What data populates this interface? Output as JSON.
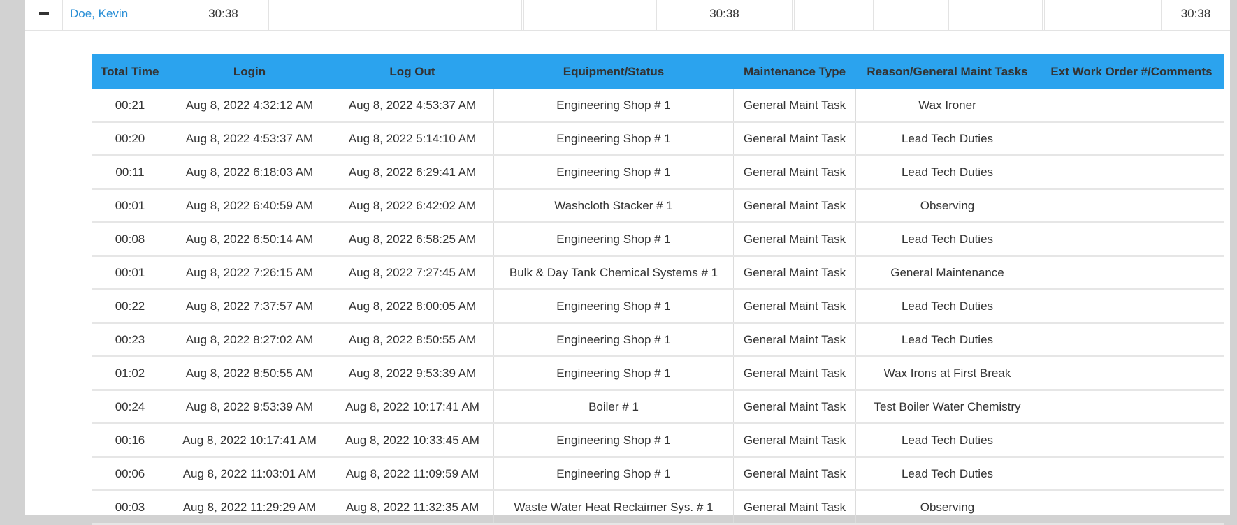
{
  "summary": {
    "employee": "Doe, Kevin",
    "total": "30:38",
    "col7": "30:38",
    "col13": "30:38"
  },
  "detail": {
    "headers": {
      "total_time": "Total Time",
      "login": "Login",
      "logout": "Log Out",
      "equipment": "Equipment/Status",
      "maint_type": "Maintenance Type",
      "reason": "Reason/General Maint Tasks",
      "comments": "Ext Work Order #/Comments"
    },
    "rows": [
      {
        "total": "00:21",
        "login": "Aug 8, 2022 4:32:12 AM",
        "logout": "Aug 8, 2022 4:53:37 AM",
        "equipment": "Engineering Shop # 1",
        "type": "General Maint Task",
        "reason": "Wax Ironer",
        "comment": ""
      },
      {
        "total": "00:20",
        "login": "Aug 8, 2022 4:53:37 AM",
        "logout": "Aug 8, 2022 5:14:10 AM",
        "equipment": "Engineering Shop # 1",
        "type": "General Maint Task",
        "reason": "Lead Tech Duties",
        "comment": ""
      },
      {
        "total": "00:11",
        "login": "Aug 8, 2022 6:18:03 AM",
        "logout": "Aug 8, 2022 6:29:41 AM",
        "equipment": "Engineering Shop # 1",
        "type": "General Maint Task",
        "reason": "Lead Tech Duties",
        "comment": ""
      },
      {
        "total": "00:01",
        "login": "Aug 8, 2022 6:40:59 AM",
        "logout": "Aug 8, 2022 6:42:02 AM",
        "equipment": "Washcloth Stacker # 1",
        "type": "General Maint Task",
        "reason": "Observing",
        "comment": ""
      },
      {
        "total": "00:08",
        "login": "Aug 8, 2022 6:50:14 AM",
        "logout": "Aug 8, 2022 6:58:25 AM",
        "equipment": "Engineering Shop # 1",
        "type": "General Maint Task",
        "reason": "Lead Tech Duties",
        "comment": ""
      },
      {
        "total": "00:01",
        "login": "Aug 8, 2022 7:26:15 AM",
        "logout": "Aug 8, 2022 7:27:45 AM",
        "equipment": "Bulk & Day Tank Chemical Systems # 1",
        "type": "General Maint Task",
        "reason": "General Maintenance",
        "comment": ""
      },
      {
        "total": "00:22",
        "login": "Aug 8, 2022 7:37:57 AM",
        "logout": "Aug 8, 2022 8:00:05 AM",
        "equipment": "Engineering Shop # 1",
        "type": "General Maint Task",
        "reason": "Lead Tech Duties",
        "comment": ""
      },
      {
        "total": "00:23",
        "login": "Aug 8, 2022 8:27:02 AM",
        "logout": "Aug 8, 2022 8:50:55 AM",
        "equipment": "Engineering Shop # 1",
        "type": "General Maint Task",
        "reason": "Lead Tech Duties",
        "comment": ""
      },
      {
        "total": "01:02",
        "login": "Aug 8, 2022 8:50:55 AM",
        "logout": "Aug 8, 2022 9:53:39 AM",
        "equipment": "Engineering Shop # 1",
        "type": "General Maint Task",
        "reason": "Wax Irons at First Break",
        "comment": ""
      },
      {
        "total": "00:24",
        "login": "Aug 8, 2022 9:53:39 AM",
        "logout": "Aug 8, 2022 10:17:41 AM",
        "equipment": "Boiler # 1",
        "type": "General Maint Task",
        "reason": "Test Boiler Water Chemistry",
        "comment": ""
      },
      {
        "total": "00:16",
        "login": "Aug 8, 2022 10:17:41 AM",
        "logout": "Aug 8, 2022 10:33:45 AM",
        "equipment": "Engineering Shop # 1",
        "type": "General Maint Task",
        "reason": "Lead Tech Duties",
        "comment": ""
      },
      {
        "total": "00:06",
        "login": "Aug 8, 2022 11:03:01 AM",
        "logout": "Aug 8, 2022 11:09:59 AM",
        "equipment": "Engineering Shop # 1",
        "type": "General Maint Task",
        "reason": "Lead Tech Duties",
        "comment": ""
      },
      {
        "total": "00:03",
        "login": "Aug 8, 2022 11:29:29 AM",
        "logout": "Aug 8, 2022 11:32:35 AM",
        "equipment": "Waste Water Heat Reclaimer Sys. # 1",
        "type": "General Maint Task",
        "reason": "Observing",
        "comment": ""
      }
    ]
  },
  "colors": {
    "header_bg": "#2ba3ee",
    "link": "#2a8fd6",
    "page_gutter": "#d2d2d2"
  }
}
